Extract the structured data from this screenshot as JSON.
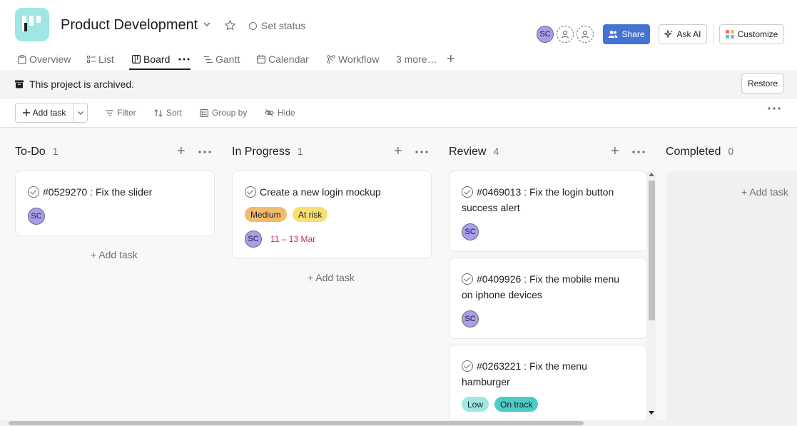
{
  "header": {
    "project_title": "Product Development",
    "set_status": "Set status",
    "avatar_initials": "SC",
    "share": "Share",
    "ask_ai": "Ask AI",
    "customize": "Customize"
  },
  "tabs": {
    "overview": "Overview",
    "list": "List",
    "board": "Board",
    "gantt": "Gantt",
    "calendar": "Calendar",
    "workflow": "Workflow",
    "more": "3 more…"
  },
  "banner": {
    "text": "This project is archived.",
    "restore": "Restore"
  },
  "toolbar": {
    "add_task": "Add task",
    "filter": "Filter",
    "sort": "Sort",
    "group_by": "Group by",
    "hide": "Hide"
  },
  "columns": [
    {
      "title": "To-Do",
      "count": "1"
    },
    {
      "title": "In Progress",
      "count": "1"
    },
    {
      "title": "Review",
      "count": "4"
    },
    {
      "title": "Completed",
      "count": "0"
    }
  ],
  "cards": {
    "todo_1": {
      "title": "#0529270 : Fix the slider",
      "assignee": "SC"
    },
    "progress_1": {
      "title": "Create a new login mockup",
      "priority": "Medium",
      "status": "At risk",
      "assignee": "SC",
      "date": "11 – 13 Mar"
    },
    "review_1": {
      "title": "#0469013 : Fix the login button success alert",
      "assignee": "SC"
    },
    "review_2": {
      "title": "#0409926 : Fix the mobile menu on iphone devices",
      "assignee": "SC"
    },
    "review_3": {
      "title": "#0263221 : Fix the menu hamburger",
      "priority": "Low",
      "status": "On track"
    }
  },
  "add_task_link": "Add task",
  "colors": {
    "share_blue": "#4573d2",
    "avatar_purple": "#a79ef0",
    "medium_orange": "#f1bd6c",
    "at_risk_yellow": "#f8df72",
    "low_teal": "#9ee7e3",
    "on_track_green": "#4ecbc4",
    "date_red": "#c92f54"
  }
}
